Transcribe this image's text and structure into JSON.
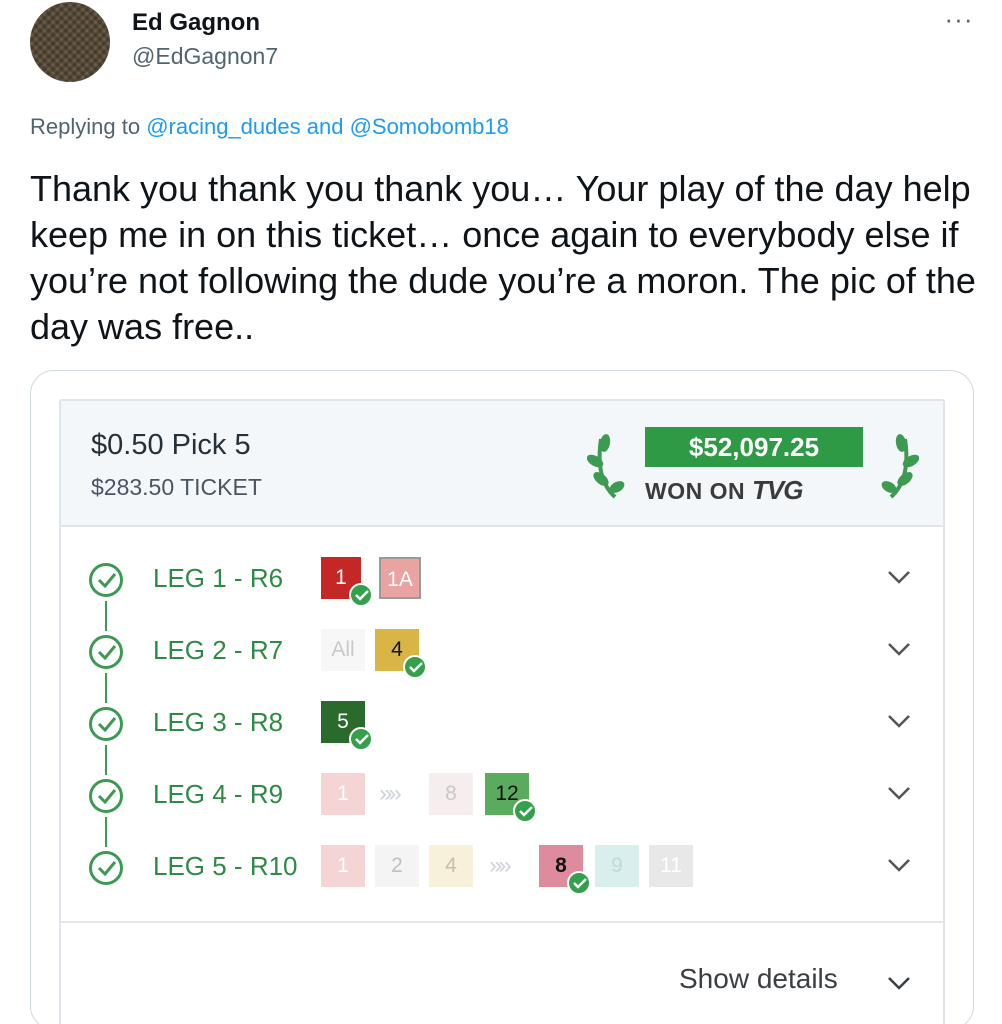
{
  "tweet": {
    "display_name": "Ed Gagnon",
    "handle": "@EdGagnon7",
    "more_label": "···",
    "reply_prefix": "Replying to ",
    "reply_mention_1": "@racing_dudes",
    "reply_and": " and ",
    "reply_mention_2": "@Somobomb18",
    "text": "Thank you thank you thank you… Your play of the day help keep me in on this ticket… once again to everybody else if you’re not following the dude you’re a moron. The pic of the day was free.."
  },
  "ticket": {
    "bet_type": "$0.50 Pick 5",
    "cost": "$283.50 TICKET",
    "win_amount": "$52,097.25",
    "won_on": "WON ON",
    "platform": "TVG",
    "show_details": "Show details",
    "legs": [
      {
        "label": "LEG 1 - R6",
        "selections": [
          "1",
          "1A"
        ]
      },
      {
        "label": "LEG 2 - R7",
        "selections": [
          "All",
          "4"
        ]
      },
      {
        "label": "LEG 3 - R8",
        "selections": [
          "5"
        ]
      },
      {
        "label": "LEG 4 - R9",
        "selections": [
          "1",
          "8",
          "12"
        ]
      },
      {
        "label": "LEG 5 - R10",
        "selections": [
          "1",
          "2",
          "4",
          "8",
          "9",
          "11"
        ]
      }
    ]
  },
  "colors": {
    "accent_blue": "#1d9bf0",
    "tvg_green": "#2f9a46",
    "leg_green": "#2f8a45"
  }
}
